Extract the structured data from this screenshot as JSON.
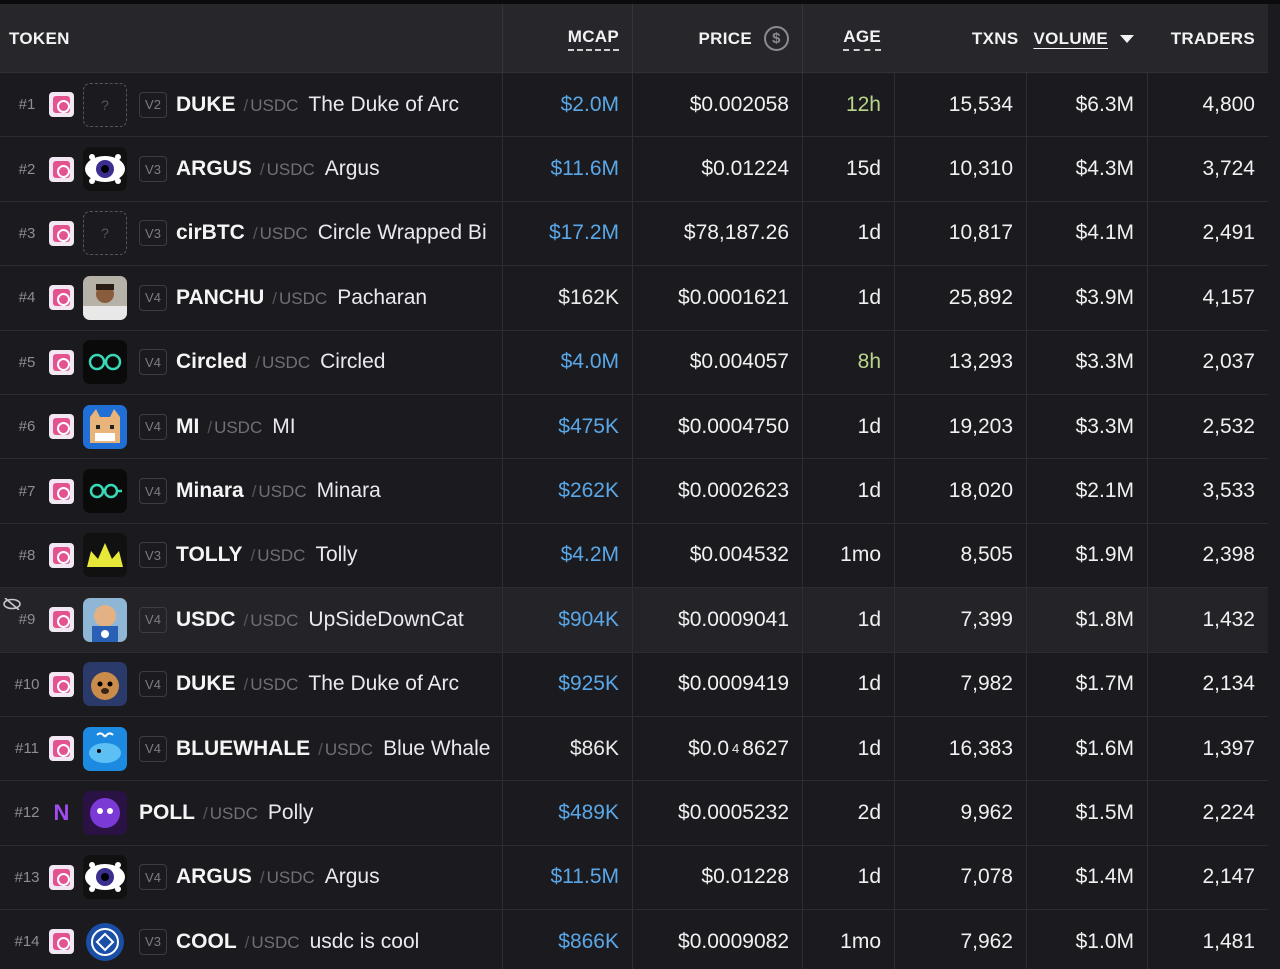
{
  "header": {
    "token": "TOKEN",
    "mcap": "MCAP",
    "price": "PRICE",
    "price_icon": "$",
    "age": "AGE",
    "txns": "TXNS",
    "volume": "VOLUME",
    "traders": "TRADERS"
  },
  "colors": {
    "mcap_blue": "#5aa7e8",
    "age_green": "#b9d58a",
    "dex_pink": "#e2538f"
  },
  "rows": [
    {
      "rank": "#1",
      "ver": "V2",
      "symbol": "DUKE",
      "quote": "USDC",
      "name": "The Duke of Arc",
      "avatar": "placeholder",
      "avatar_text": "?",
      "mcap": "$2.0M",
      "price": "$0.002058",
      "age": "12h",
      "txns": "15,534",
      "volume": "$6.3M",
      "traders": "4,800"
    },
    {
      "rank": "#2",
      "ver": "V3",
      "symbol": "ARGUS",
      "quote": "USDC",
      "name": "Argus",
      "avatar": "eye",
      "avatar_text": "",
      "mcap": "$11.6M",
      "price": "$0.01224",
      "age": "15d",
      "txns": "10,310",
      "volume": "$4.3M",
      "traders": "3,724"
    },
    {
      "rank": "#3",
      "ver": "V3",
      "symbol": "cirBTC",
      "quote": "USDC",
      "name": "Circle Wrapped Bi",
      "avatar": "placeholder",
      "avatar_text": "?",
      "mcap": "$17.2M",
      "price": "$78,187.26",
      "age": "1d",
      "txns": "10,817",
      "volume": "$4.1M",
      "traders": "2,491"
    },
    {
      "rank": "#4",
      "ver": "V4",
      "symbol": "PANCHU",
      "quote": "USDC",
      "name": "Pacharan",
      "avatar": "photo",
      "avatar_text": "",
      "mcap": "$162K",
      "price": "$0.0001621",
      "age": "1d",
      "txns": "25,892",
      "volume": "$3.9M",
      "traders": "4,157"
    },
    {
      "rank": "#5",
      "ver": "V4",
      "symbol": "Circled",
      "quote": "USDC",
      "name": "Circled",
      "avatar": "glasses",
      "avatar_text": "",
      "mcap": "$4.0M",
      "price": "$0.004057",
      "age": "8h",
      "txns": "13,293",
      "volume": "$3.3M",
      "traders": "2,037"
    },
    {
      "rank": "#6",
      "ver": "V4",
      "symbol": "MI",
      "quote": "USDC",
      "name": "MI",
      "avatar": "cat",
      "avatar_text": "",
      "mcap": "$475K",
      "price": "$0.0004750",
      "age": "1d",
      "txns": "19,203",
      "volume": "$3.3M",
      "traders": "2,532"
    },
    {
      "rank": "#7",
      "ver": "V4",
      "symbol": "Minara",
      "quote": "USDC",
      "name": "Minara",
      "avatar": "glasses2",
      "avatar_text": "",
      "mcap": "$262K",
      "price": "$0.0002623",
      "age": "1d",
      "txns": "18,020",
      "volume": "$2.1M",
      "traders": "3,533"
    },
    {
      "rank": "#8",
      "ver": "V3",
      "symbol": "TOLLY",
      "quote": "USDC",
      "name": "Tolly",
      "avatar": "crown",
      "avatar_text": "",
      "mcap": "$4.2M",
      "price": "$0.004532",
      "age": "1mo",
      "txns": "8,505",
      "volume": "$1.9M",
      "traders": "2,398"
    },
    {
      "rank": "#9",
      "ver": "V4",
      "symbol": "USDC",
      "quote": "USDC",
      "name": "UpSideDownCat",
      "avatar": "catblue",
      "avatar_text": "",
      "mcap": "$904K",
      "price": "$0.0009041",
      "age": "1d",
      "txns": "7,399",
      "volume": "$1.8M",
      "traders": "1,432"
    },
    {
      "rank": "#10",
      "ver": "V4",
      "symbol": "DUKE",
      "quote": "USDC",
      "name": "The Duke of Arc",
      "avatar": "dog",
      "avatar_text": "",
      "mcap": "$925K",
      "price": "$0.0009419",
      "age": "1d",
      "txns": "7,982",
      "volume": "$1.7M",
      "traders": "2,134"
    },
    {
      "rank": "#11",
      "ver": "V4",
      "symbol": "BLUEWHALE",
      "quote": "USDC",
      "name": "Blue Whale",
      "avatar": "whale",
      "avatar_text": "",
      "mcap": "$86K",
      "price_main": "$0.0",
      "price_sub": "4",
      "price_rest": "8627",
      "age": "1d",
      "txns": "16,383",
      "volume": "$1.6M",
      "traders": "1,397"
    },
    {
      "rank": "#12",
      "ver": "",
      "symbol": "POLL",
      "quote": "USDC",
      "name": "Polly",
      "avatar": "ghost",
      "avatar_text": "",
      "mcap": "$489K",
      "price": "$0.0005232",
      "age": "2d",
      "txns": "9,962",
      "volume": "$1.5M",
      "traders": "2,224"
    },
    {
      "rank": "#13",
      "ver": "V4",
      "symbol": "ARGUS",
      "quote": "USDC",
      "name": "Argus",
      "avatar": "eye",
      "avatar_text": "",
      "mcap": "$11.5M",
      "price": "$0.01228",
      "age": "1d",
      "txns": "7,078",
      "volume": "$1.4M",
      "traders": "2,147"
    },
    {
      "rank": "#14",
      "ver": "V3",
      "symbol": "COOL",
      "quote": "USDC",
      "name": "usdc is cool",
      "avatar": "coin",
      "avatar_text": "",
      "mcap": "$866K",
      "price": "$0.0009082",
      "age": "1mo",
      "txns": "7,962",
      "volume": "$1.0M",
      "traders": "1,481"
    }
  ]
}
